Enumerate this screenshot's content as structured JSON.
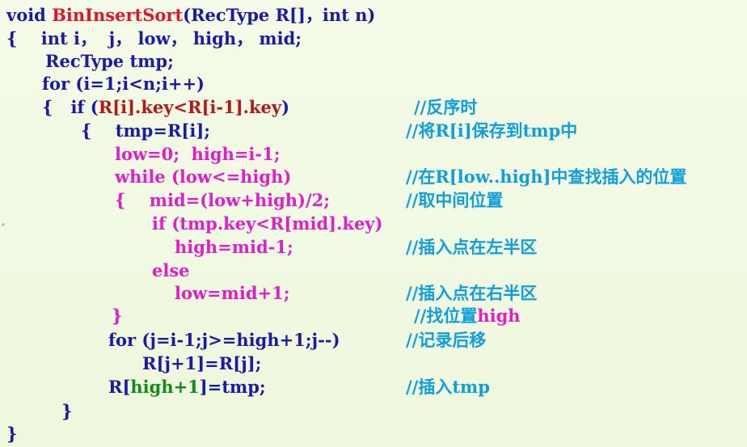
{
  "code": {
    "l1_a": "void ",
    "l1_fn": "BinInsertSort",
    "l1_b": "(RecType R[]，int n)",
    "l2": "{    int i，  j， low， high， mid;",
    "l3": "RecType tmp;",
    "l4": "for (i=1;i<n;i++)",
    "l5_a": "{   if (",
    "l5_cond": "R[i].key<R[i-1].key",
    "l5_b": ")",
    "l6_a": "{    ",
    "l6_b": "tmp=R[i];",
    "l7": "low=0;  high=i-1;",
    "l8": "while (low<=high)",
    "l9_a": "{    ",
    "l9_b": "mid=(low+high)/2;",
    "l10": "if (tmp.key<R[mid].key)",
    "l11": "high=mid-1;",
    "l12": "else",
    "l13": "low=mid+1;",
    "l14": "}",
    "l15": "for (j=i-1;j>=high+1;j--)",
    "l16": "R[j+1]=R[j];",
    "l17_a": "R[",
    "l17_b": "high+1",
    "l17_c": "]=tmp;",
    "l18": "}",
    "l19": "}"
  },
  "comments": {
    "c5": "//反序时",
    "c6": "//将R[i]保存到tmp中",
    "c8": "//在R[low..high]中查找插入的位置",
    "c9": "//取中间位置",
    "c11": "//插入点在左半区",
    "c13": "//插入点在右半区",
    "c14_a": "//找位置",
    "c14_b": "high",
    "c15": "//记录后移",
    "c17": "//插入tmp"
  },
  "colors": {
    "keyword_text": "#1a1aa6",
    "function_name": "#e0142a",
    "highlight_magenta": "#e31ccf",
    "comment_cyan": "#0f9fdc",
    "condition_darkred": "#b51818",
    "green": "#138a1c",
    "background": "#f2fae4"
  }
}
